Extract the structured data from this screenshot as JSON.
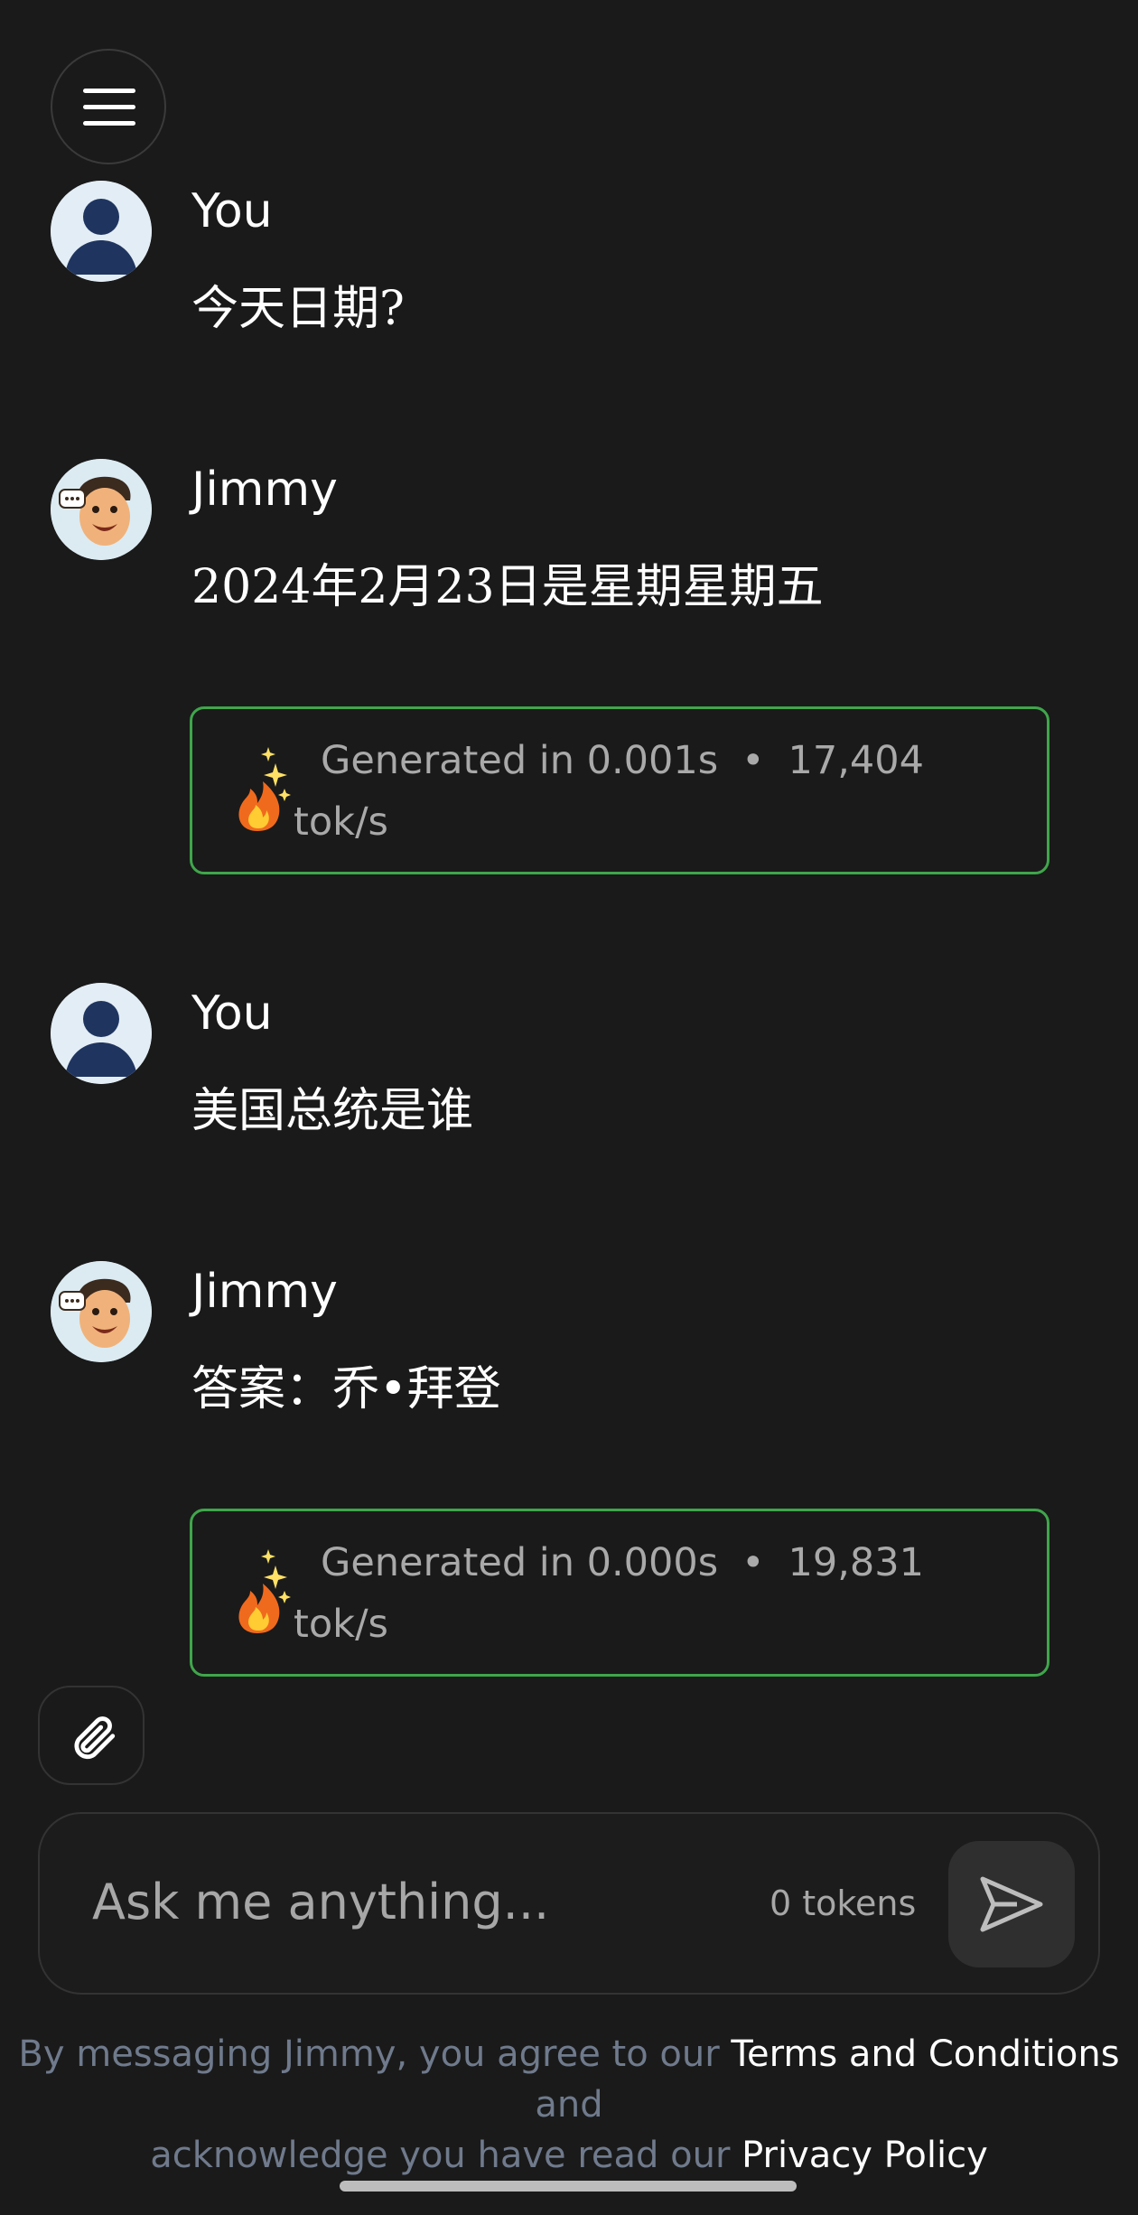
{
  "header": {
    "menu_icon": "hamburger-icon"
  },
  "messages": [
    {
      "sender": "You",
      "text": "今天日期?",
      "avatar": "user-avatar"
    },
    {
      "sender": "Jimmy",
      "text": "2024年2月23日是星期星期五",
      "avatar": "jimmy-avatar",
      "stats": {
        "generated": "Generated in 0.001s",
        "separator": "•",
        "rate": "17,404",
        "unit": "tok/s",
        "icon": "fire-sparkle-icon"
      }
    },
    {
      "sender": "You",
      "text": "美国总统是谁",
      "avatar": "user-avatar"
    },
    {
      "sender": "Jimmy",
      "text": "答案：乔•拜登",
      "avatar": "jimmy-avatar",
      "stats": {
        "generated": "Generated in 0.000s",
        "separator": "•",
        "rate": "19,831",
        "unit": "tok/s",
        "icon": "fire-sparkle-icon"
      }
    }
  ],
  "composer": {
    "placeholder": "Ask me anything...",
    "token_count": "0 tokens",
    "attach_icon": "paperclip-icon",
    "send_icon": "send-icon"
  },
  "footer": {
    "text_1": "By messaging Jimmy, you agree to our",
    "terms_link": "Terms and Conditions",
    "text_2": "and",
    "text_3": "acknowledge you have read our",
    "privacy_link": "Privacy Policy"
  },
  "colors": {
    "background": "#1a1a1a",
    "accent_border": "#3fa64b",
    "muted_text": "#a9a9a9",
    "footer_text": "#6f7a8c"
  }
}
